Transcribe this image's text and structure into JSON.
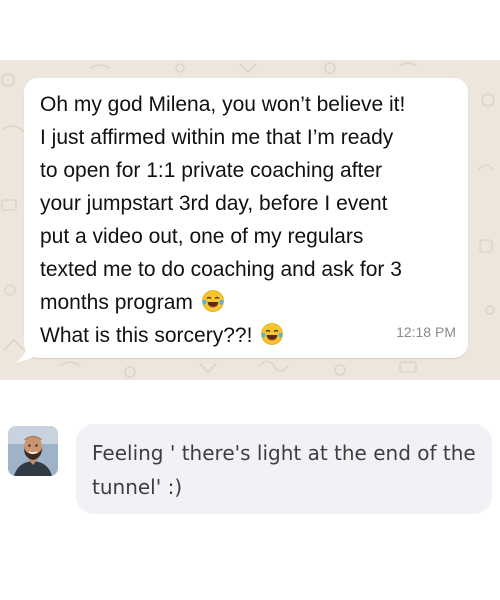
{
  "incoming_message": {
    "lines": [
      "Oh my god Milena, you won’t believe it!",
      "I just affirmed within me that I’m ready",
      "to open for 1:1 private coaching after",
      "your jumpstart 3rd day, before I event",
      "put a video out, one of my regulars",
      "texted me to do coaching and ask for 3",
      "months program",
      "What is this sorcery??!"
    ],
    "emoji": "laughing-tears-emoji",
    "timestamp": "12:18 PM"
  },
  "reply": {
    "text": "Feeling ' there's light at the end of the tunnel' :)",
    "avatar": "user-avatar"
  },
  "colors": {
    "wallpaper": "#ece6dc",
    "bubble": "#ffffff",
    "reply_bubble": "#f1f2f6",
    "timestamp": "#8a8a8a"
  }
}
